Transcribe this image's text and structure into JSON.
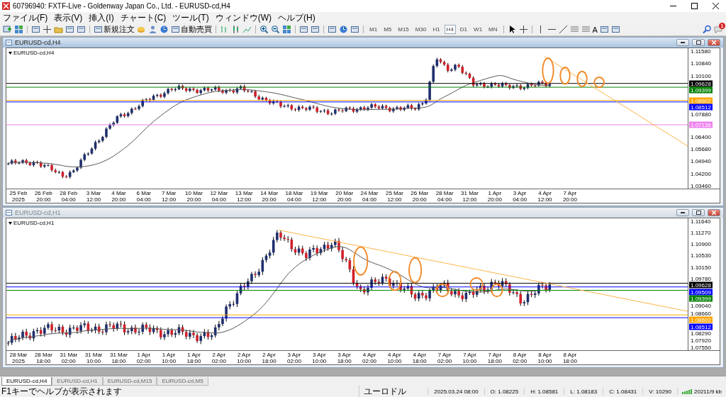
{
  "window": {
    "title": "60796940: FXTF-Live - Goldenway Japan Co., Ltd. - EURUSD-cd,H4"
  },
  "menu": [
    {
      "label": "ファイル(F)"
    },
    {
      "label": "表示(V)"
    },
    {
      "label": "挿入(I)"
    },
    {
      "label": "チャート(C)"
    },
    {
      "label": "ツール(T)"
    },
    {
      "label": "ウィンドウ(W)"
    },
    {
      "label": "ヘルプ(H)"
    }
  ],
  "toolbar": {
    "buttons": [
      {
        "label": "新規注文"
      },
      {
        "label": "自動売買"
      }
    ],
    "timeframes": [
      {
        "label": "M1",
        "selected": false
      },
      {
        "label": "M5",
        "selected": false
      },
      {
        "label": "M15",
        "selected": false
      },
      {
        "label": "M30",
        "selected": false
      },
      {
        "label": "H1",
        "selected": false
      },
      {
        "label": "H4",
        "selected": true
      },
      {
        "label": "D1",
        "selected": false
      },
      {
        "label": "W1",
        "selected": false
      },
      {
        "label": "MN",
        "selected": false
      }
    ],
    "text_tool": "A",
    "notification_count": "1"
  },
  "charts": [
    {
      "title": "EURUSD-cd,H4",
      "label": "EURUSD-cd,H4",
      "active": true,
      "price_ticks": [
        "1.11580",
        "1.10840",
        "1.10100",
        "1.07880",
        "1.06400",
        "1.05680",
        "1.04940",
        "1.04200",
        "1.03460"
      ],
      "price_tags": [
        {
          "text": "1.09628",
          "color": "#000000"
        },
        {
          "text": "1.09399",
          "color": "#008000"
        },
        {
          "text": "1.08602",
          "color": "#ffa500"
        },
        {
          "text": "1.08512",
          "color": "#0000ff"
        },
        {
          "text": "1.07136",
          "color": "#ee82ee"
        }
      ],
      "time_ticks": [
        "25 Feb 2025",
        "26 Feb 20:00",
        "28 Feb 04:00",
        "3 Mar 12:00",
        "4 Mar 20:00",
        "6 Mar 04:00",
        "7 Mar 12:00",
        "10 Mar 20:00",
        "12 Mar 04:00",
        "13 Mar 12:00",
        "14 Mar 20:00",
        "18 Mar 04:00",
        "19 Mar 12:00",
        "20 Mar 20:00",
        "24 Mar 04:00",
        "25 Mar 12:00",
        "26 Mar 20:00",
        "28 Mar 04:00",
        "31 Mar 12:00",
        "1 Apr 20:00",
        "3 Apr 04:00",
        "4 Apr 12:00",
        "7 Apr 20:00"
      ]
    },
    {
      "title": "EURUSD-cd,H1",
      "label": "EURUSD-cd,H1",
      "active": false,
      "price_ticks": [
        "1.11640",
        "1.11270",
        "1.10900",
        "1.10530",
        "1.10150",
        "1.09780",
        "1.09040",
        "1.08660",
        "1.08290",
        "1.07920",
        "1.07550"
      ],
      "price_tags": [
        {
          "text": "1.09628",
          "color": "#000000"
        },
        {
          "text": "1.09509",
          "color": "#0000ff"
        },
        {
          "text": "1.09399",
          "color": "#008000"
        },
        {
          "text": "1.08602",
          "color": "#ffa500"
        },
        {
          "text": "1.08512",
          "color": "#0000ff"
        }
      ],
      "time_ticks": [
        "28 Mar 2025",
        "28 Mar 18:00",
        "31 Mar 02:00",
        "31 Mar 10:00",
        "31 Mar 18:00",
        "1 Apr 02:00",
        "1 Apr 10:00",
        "1 Apr 18:00",
        "2 Apr 02:00",
        "2 Apr 10:00",
        "2 Apr 18:00",
        "3 Apr 02:00",
        "3 Apr 10:00",
        "3 Apr 18:00",
        "4 Apr 02:00",
        "4 Apr 10:00",
        "4 Apr 18:00",
        "7 Apr 02:00",
        "7 Apr 10:00",
        "7 Apr 18:00",
        "8 Apr 02:00",
        "8 Apr 10:00",
        "8 Apr 18:00"
      ]
    }
  ],
  "tabs": [
    {
      "label": "EURUSD-cd,H4",
      "selected": true
    },
    {
      "label": "EURUSD-cd,H1",
      "selected": false
    },
    {
      "label": "EURUSD-cd,M15",
      "selected": false
    },
    {
      "label": "EURUSD-cd,M5",
      "selected": false
    }
  ],
  "status_bar": {
    "help": "F1キーでヘルプが表示されます",
    "symbol": "ユーロドル",
    "time": "2025.03.24 08:00",
    "open": "O: 1.08225",
    "high": "H: 1.08581",
    "low": "L: 1.08183",
    "close": "C: 1.08431",
    "volume": "V: 10290",
    "traffic": "20211/9 kb"
  }
}
